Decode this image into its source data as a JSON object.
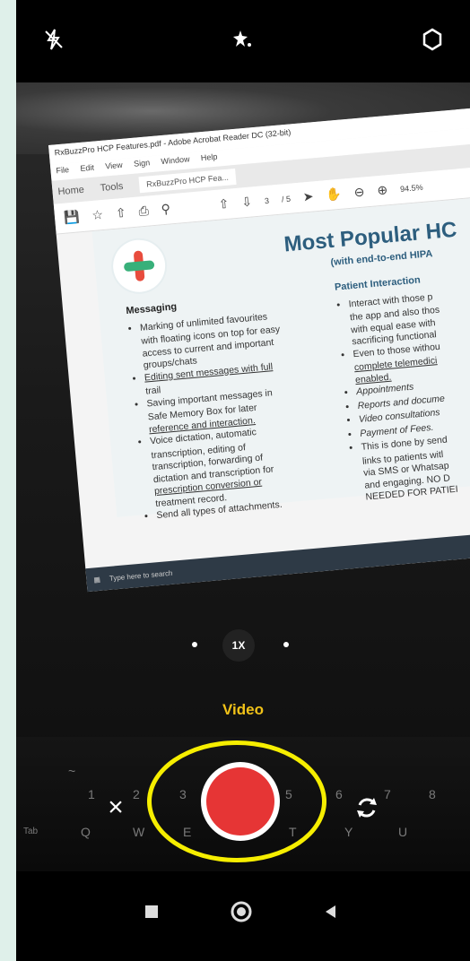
{
  "camera": {
    "mode_label": "Video",
    "zoom_label": "1X",
    "icons": {
      "flash": "flash-off-icon",
      "effects": "effects-icon",
      "settings": "settings-icon",
      "close": "close-icon",
      "record": "record-button",
      "switch": "switch-camera-icon"
    }
  },
  "captured_screen": {
    "window_title": "RxBuzzPro HCP Features.pdf - Adobe Acrobat Reader DC (32-bit)",
    "menu": [
      "File",
      "Edit",
      "View",
      "Sign",
      "Window",
      "Help"
    ],
    "tabs": [
      "Home",
      "Tools"
    ],
    "doc_tab": "RxBuzzPro HCP Fea...",
    "page_current": "3",
    "page_total": "/ 5",
    "zoom": "94.5%",
    "taskbar_search": "Type here to search",
    "document": {
      "title": "Most Popular HC",
      "subtitle": "(with end-to-end HIPA",
      "col1_heading": "Messaging",
      "col1_items": [
        "Marking of unlimited favourites",
        "with floating icons on top for easy",
        "access to current and important",
        "groups/chats",
        "Editing sent messages with full",
        "trail",
        "Saving important messages in",
        "Safe Memory Box for later",
        "reference and interaction.",
        "Voice dictation, automatic",
        "transcription, editing of",
        "transcription, forwarding of",
        "dictation and transcription for",
        "prescription conversion or",
        "treatment record.",
        "Send all types of attachments."
      ],
      "col2_heading": "Patient Interaction",
      "col2_items": [
        "Interact with those p",
        "the app and also thos",
        "with equal ease with",
        "sacrificing functional",
        "Even to those withou",
        "complete telemedici",
        "enabled.",
        "Appointments",
        "Reports and docume",
        "Video consultations",
        "Payment of Fees.",
        "This is done by send",
        "links to patients witl",
        "via SMS or Whatsap",
        "and engaging. NO D",
        "NEEDED FOR PATIEI"
      ]
    }
  },
  "colors": {
    "accent": "#f1c218",
    "record": "#e63535",
    "highlight_ring": "#f6ee00"
  }
}
